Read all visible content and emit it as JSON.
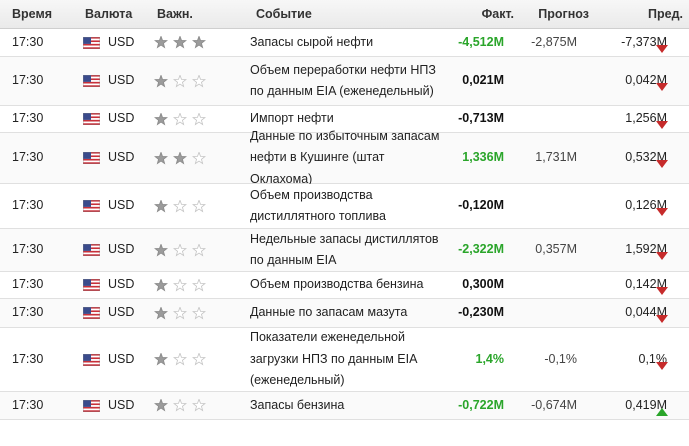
{
  "headers": {
    "time": "Время",
    "currency": "Валюта",
    "importance": "Важн.",
    "event": "Событие",
    "actual": "Факт.",
    "forecast": "Прогноз",
    "previous": "Пред."
  },
  "colors": {
    "green": "#2aa52a",
    "red": "#cc1f1f",
    "star_on": "#9b9b9b",
    "star_off": "#d2d2d2"
  },
  "rows": [
    {
      "time": "17:30",
      "currency": "USD",
      "stars": 3,
      "event": "Запасы сырой нефти",
      "actual": "-4,512M",
      "actual_color": "green",
      "forecast": "-2,875M",
      "previous": "-7,373M",
      "arrow": "down"
    },
    {
      "time": "17:30",
      "currency": "USD",
      "stars": 1,
      "event": "Объем переработки нефти НПЗ по данным EIA (еженедельный)",
      "actual": "0,021M",
      "actual_color": "black",
      "forecast": "",
      "previous": "0,042M",
      "arrow": "down"
    },
    {
      "time": "17:30",
      "currency": "USD",
      "stars": 1,
      "event": "Импорт нефти",
      "actual": "-0,713M",
      "actual_color": "black",
      "forecast": "",
      "previous": "1,256M",
      "arrow": "down"
    },
    {
      "time": "17:30",
      "currency": "USD",
      "stars": 2,
      "event": "Данные по избыточным запасам нефти в Кушинге (штат Оклахома)",
      "actual": "1,336M",
      "actual_color": "green",
      "forecast": "1,731M",
      "previous": "0,532M",
      "arrow": "down"
    },
    {
      "time": "17:30",
      "currency": "USD",
      "stars": 1,
      "event": "Объем производства дистиллятного топлива",
      "actual": "-0,120M",
      "actual_color": "black",
      "forecast": "",
      "previous": "0,126M",
      "arrow": "down"
    },
    {
      "time": "17:30",
      "currency": "USD",
      "stars": 1,
      "event": "Недельные запасы дистиллятов по данным EIA",
      "actual": "-2,322M",
      "actual_color": "green",
      "forecast": "0,357M",
      "previous": "1,592M",
      "arrow": "down"
    },
    {
      "time": "17:30",
      "currency": "USD",
      "stars": 1,
      "event": "Объем производства бензина",
      "actual": "0,300M",
      "actual_color": "black",
      "forecast": "",
      "previous": "0,142M",
      "arrow": "down"
    },
    {
      "time": "17:30",
      "currency": "USD",
      "stars": 1,
      "event": "Данные по запасам мазута",
      "actual": "-0,230M",
      "actual_color": "black",
      "forecast": "",
      "previous": "0,044M",
      "arrow": "down"
    },
    {
      "time": "17:30",
      "currency": "USD",
      "stars": 1,
      "event": "Показатели еженедельной загрузки НПЗ по данным EIA (еженедельный)",
      "actual": "1,4%",
      "actual_color": "green",
      "forecast": "-0,1%",
      "previous": "0,1%",
      "arrow": "down"
    },
    {
      "time": "17:30",
      "currency": "USD",
      "stars": 1,
      "event": "Запасы бензина",
      "actual": "-0,722M",
      "actual_color": "green",
      "forecast": "-0,674M",
      "previous": "0,419M",
      "arrow": "up"
    }
  ]
}
